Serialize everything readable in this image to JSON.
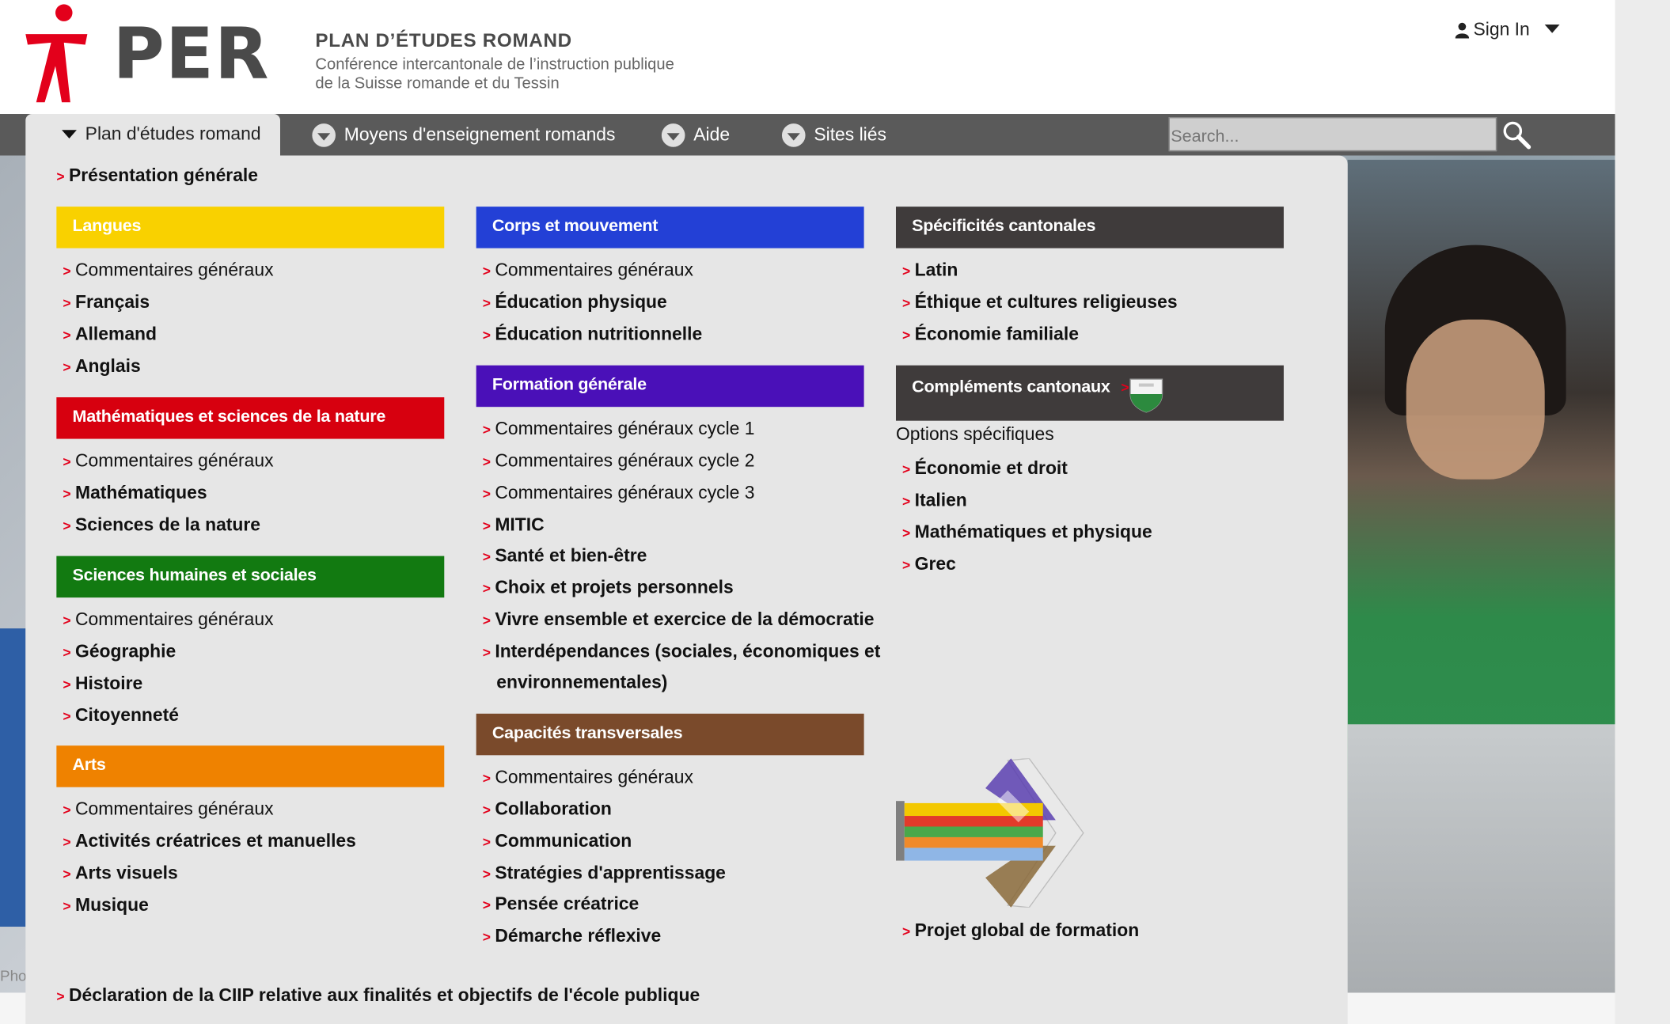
{
  "header": {
    "logo_text": "PER",
    "org_name": "PLAN D’ÉTUDES ROMAND",
    "org_sub_line1": "Conférence intercantonale de l’instruction publique",
    "org_sub_line2": "de la Suisse romande et du Tessin",
    "signin_label": "Sign In"
  },
  "nav": {
    "items": [
      {
        "label": "Plan d'études romand"
      },
      {
        "label": "Moyens d'enseignement romands"
      },
      {
        "label": "Aide"
      },
      {
        "label": "Sites liés"
      }
    ],
    "search_placeholder": "Search..."
  },
  "menu": {
    "intro": "Présentation générale",
    "col1": [
      {
        "title": "Langues",
        "color": "#f9d100",
        "links": [
          "Commentaires généraux",
          "Français",
          "Allemand",
          "Anglais"
        ]
      },
      {
        "title": "Mathématiques et sciences de la nature",
        "color": "#d7000f",
        "links": [
          "Commentaires généraux",
          "Mathématiques",
          "Sciences de la nature"
        ]
      },
      {
        "title": "Sciences humaines et sociales",
        "color": "#127a11",
        "links": [
          "Commentaires généraux",
          "Géographie",
          "Histoire",
          "Citoyenneté"
        ]
      },
      {
        "title": "Arts",
        "color": "#ef8200",
        "links": [
          "Commentaires généraux",
          "Activités créatrices et manuelles",
          "Arts visuels",
          "Musique"
        ]
      }
    ],
    "col2": [
      {
        "title": "Corps et mouvement",
        "color": "#2340d6",
        "links": [
          "Commentaires généraux",
          "Éducation physique",
          "Éducation nutritionnelle"
        ]
      },
      {
        "title": "Formation générale",
        "color": "#4a10b8",
        "links": [
          "Commentaires généraux cycle 1",
          "Commentaires généraux cycle 2",
          "Commentaires généraux cycle 3",
          "MITIC",
          "Santé et bien-être",
          "Choix et projets personnels",
          "Vivre ensemble et exercice de la démocratie",
          "Interdépendances (sociales, économiques et",
          "environnementales)"
        ]
      },
      {
        "title": "Capacités transversales",
        "color": "#7a4a2b",
        "links": [
          "Commentaires généraux",
          "Collaboration",
          "Communication",
          "Stratégies d'apprentissage",
          "Pensée créatrice",
          "Démarche réflexive"
        ]
      }
    ],
    "col3": [
      {
        "title": "Spécificités cantonales",
        "color": "#3f3b3b",
        "links": [
          "Latin",
          "Éthique et cultures religieuses",
          "Économie familiale"
        ]
      },
      {
        "title": "Compléments cantonaux",
        "color": "#3f3b3b",
        "subtitle": "Options spécifiques",
        "links": [
          "Économie et droit",
          "Italien",
          "Mathématiques et physique",
          "Grec"
        ]
      }
    ],
    "project_link": "Projet global de formation",
    "declaration": "Déclaration de la CIIP relative aux finalités et objectifs de l'école publique"
  },
  "hero": {
    "photo_credit": "Pho"
  },
  "colors": {
    "nav_bg": "#5a5a5a",
    "panel_bg": "#e6e6e6",
    "arrow_red": "#e3001b"
  }
}
